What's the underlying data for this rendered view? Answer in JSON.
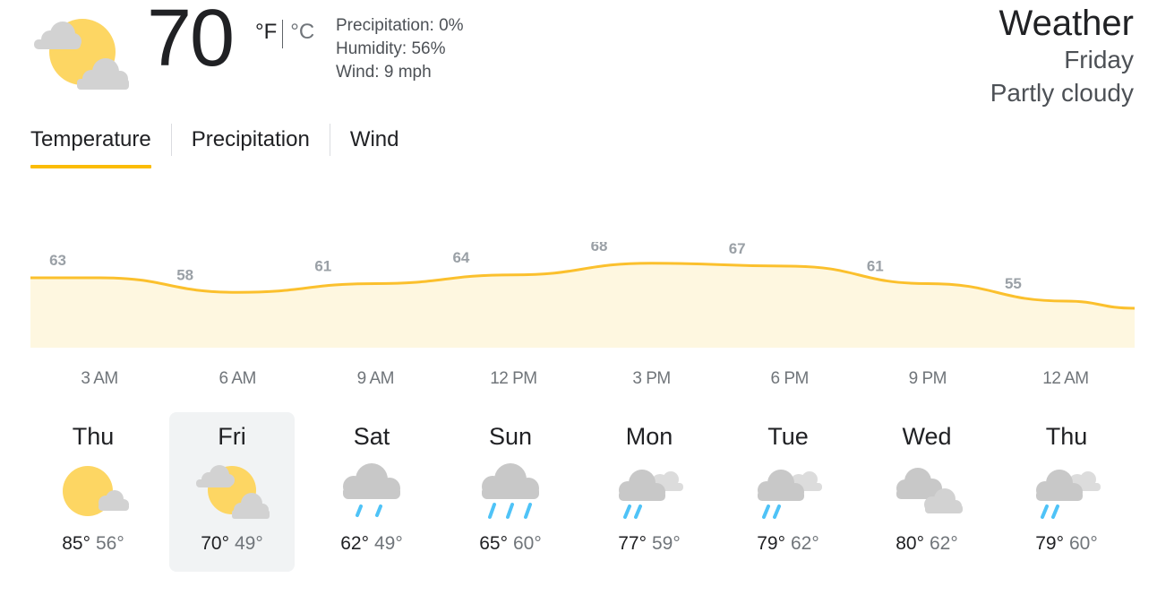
{
  "current": {
    "temperature": "70",
    "unit_f": "°F",
    "unit_c": "°C",
    "icon": "partly-cloudy-icon",
    "precipitation": "Precipitation: 0%",
    "humidity": "Humidity: 56%",
    "wind": "Wind: 9 mph"
  },
  "header": {
    "title": "Weather",
    "day": "Friday",
    "condition": "Partly cloudy"
  },
  "tabs": [
    {
      "label": "Temperature",
      "active": true
    },
    {
      "label": "Precipitation",
      "active": false
    },
    {
      "label": "Wind",
      "active": false
    }
  ],
  "colors": {
    "accent": "#fbbc04",
    "chart_fill": "#fef7e0",
    "chart_line": "#fbc02d",
    "sun": "#fdd663",
    "cloud": "#d2d2d2",
    "rain": "#4fc3f7"
  },
  "chart_data": {
    "type": "area",
    "x": [
      "3 AM",
      "6 AM",
      "9 AM",
      "12 PM",
      "3 PM",
      "6 PM",
      "9 PM",
      "12 AM"
    ],
    "values": [
      63,
      58,
      61,
      64,
      68,
      67,
      61,
      55
    ],
    "labels": [
      "63",
      "58",
      "61",
      "64",
      "68",
      "67",
      "61",
      "55"
    ]
  },
  "days": [
    {
      "name": "Thu",
      "high": "85°",
      "low": "56°",
      "icon": "mostly-sunny-icon",
      "selected": false
    },
    {
      "name": "Fri",
      "high": "70°",
      "low": "49°",
      "icon": "partly-cloudy-icon",
      "selected": true
    },
    {
      "name": "Sat",
      "high": "62°",
      "low": "49°",
      "icon": "light-rain-icon",
      "selected": false
    },
    {
      "name": "Sun",
      "high": "65°",
      "low": "60°",
      "icon": "rain-icon",
      "selected": false
    },
    {
      "name": "Mon",
      "high": "77°",
      "low": "59°",
      "icon": "scattered-showers-icon",
      "selected": false
    },
    {
      "name": "Tue",
      "high": "79°",
      "low": "62°",
      "icon": "scattered-showers-icon",
      "selected": false
    },
    {
      "name": "Wed",
      "high": "80°",
      "low": "62°",
      "icon": "cloudy-icon",
      "selected": false
    },
    {
      "name": "Thu",
      "high": "79°",
      "low": "60°",
      "icon": "scattered-showers-icon",
      "selected": false
    }
  ]
}
